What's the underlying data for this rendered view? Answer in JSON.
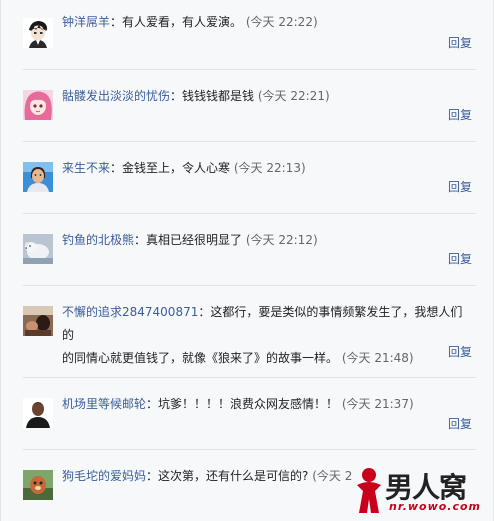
{
  "comments": [
    {
      "name": "钟洋屌羊",
      "sep": "：",
      "text": "有人爱看，有人爱演。",
      "time": "(今天 22:22)",
      "reply": "回复",
      "avatar_icon": "anime-boy-avatar-icon"
    },
    {
      "name": "骷髅发出淡淡的忧伤",
      "sep": "：",
      "text": "钱钱钱都是钱",
      "time": "(今天 22:21)",
      "reply": "回复",
      "avatar_icon": "pink-hair-girl-avatar-icon"
    },
    {
      "name": "来生不来",
      "sep": "：",
      "text": "金钱至上，令人心寒",
      "time": "(今天 22:13)",
      "reply": "回复",
      "avatar_icon": "woman-photo-avatar-icon"
    },
    {
      "name": "钓鱼的北极熊",
      "sep": "：",
      "text": "真相已经很明显了",
      "time": "(今天 22:12)",
      "reply": "回复",
      "avatar_icon": "polar-bear-avatar-icon"
    },
    {
      "name": "不懈的追求2847400871",
      "sep": "：",
      "text_line1": "这都行，要是类似的事情频繁发生了，我想人们的",
      "text_line2": "的同情心就更值钱了，就像《狼来了》的故事一样。",
      "time": "(今天 21:48)",
      "reply": "回复",
      "avatar_icon": "person-photo-avatar-icon"
    },
    {
      "name": "机场里等候邮轮",
      "sep": "：",
      "text": "坑爹！！！！浪费众网友感情！！",
      "time": "(今天 21:37)",
      "reply": "回复",
      "avatar_icon": "man-photo-avatar-icon"
    },
    {
      "name": "狗毛坨的爱妈妈",
      "sep": "：",
      "text": "这次第，还有什么是可信的?",
      "time": "(今天 2",
      "avatar_icon": "cartoon-avatar-icon"
    }
  ],
  "watermark": {
    "brand": "男人窝",
    "url": "nr.wowo.com",
    "accent": "#c8001c"
  }
}
